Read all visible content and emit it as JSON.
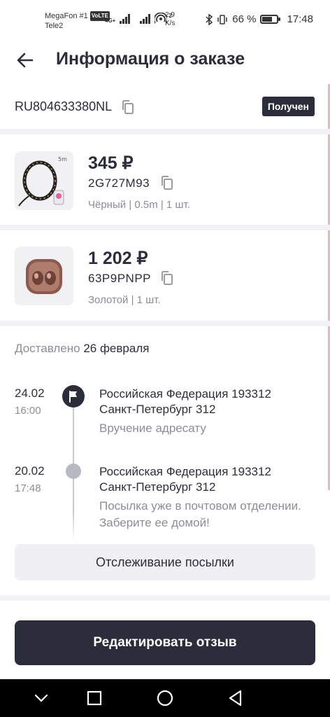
{
  "status_bar": {
    "carrier1": "MegaFon #1",
    "volte": "VoLTE",
    "carrier2": "Tele2",
    "net_type": "4G+",
    "wifi_num": "2",
    "speed_value": "2,9",
    "speed_unit": "K/s",
    "battery_percent": "66 %",
    "battery_level": 0.66,
    "time": "17:48"
  },
  "header": {
    "title": "Информация о заказе",
    "back_icon": "arrow-left-icon"
  },
  "order": {
    "number": "RU804633380NL",
    "status": "Получен"
  },
  "products": [
    {
      "price": "345 ₽",
      "sku": "2G727M93",
      "variant": "Чёрный | 0.5m | 1 шт.",
      "thumb_label": "5m"
    },
    {
      "price": "1 202 ₽",
      "sku": "63P9PNPP",
      "variant": "Золотой | 1 шт."
    }
  ],
  "delivery": {
    "label": "Доставлено",
    "date": "26 февраля"
  },
  "timeline": [
    {
      "date": "24.02",
      "time": "16:00",
      "address": "Российская Федерация 193312 Санкт-Петербург 312",
      "description": "Вручение адресату",
      "icon": "flag-icon"
    },
    {
      "date": "20.02",
      "time": "17:48",
      "address": "Российская Федерация 193312 Санкт-Петербург 312",
      "description": "Посылка уже в почтовом отделении. Заберите ее домой!",
      "icon": "dot-icon"
    }
  ],
  "buttons": {
    "track": "Отслеживание посылки",
    "edit_review": "Редактировать отзыв"
  },
  "colors": {
    "primary_dark": "#2b2d3a",
    "muted": "#8c8d96",
    "separator": "#f2f2f6"
  }
}
